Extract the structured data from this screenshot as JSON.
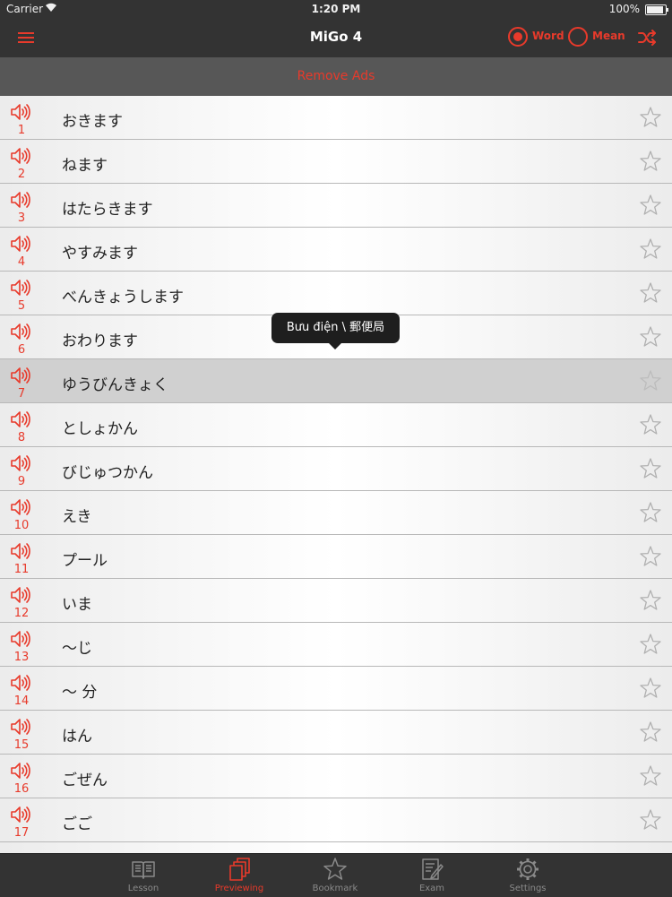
{
  "status_bar": {
    "carrier": "Carrier",
    "time": "1:20 PM",
    "battery": "100%",
    "battery_level": 1.0
  },
  "nav": {
    "title": "MiGo 4",
    "word_label": "Word",
    "mean_label": "Mean",
    "word_selected": true,
    "mean_selected": false,
    "accent_color": "#e83a2b"
  },
  "ads": {
    "label": "Remove Ads"
  },
  "tooltip": {
    "text": "Bưu điện \\ 郵便局"
  },
  "list": {
    "selected_index": 7,
    "items": [
      {
        "num": "1",
        "word": "おきます"
      },
      {
        "num": "2",
        "word": "ねます"
      },
      {
        "num": "3",
        "word": "はたらきます"
      },
      {
        "num": "4",
        "word": "やすみます"
      },
      {
        "num": "5",
        "word": "べんきょうします"
      },
      {
        "num": "6",
        "word": "おわります"
      },
      {
        "num": "7",
        "word": "ゆうびんきょく"
      },
      {
        "num": "8",
        "word": "としょかん"
      },
      {
        "num": "9",
        "word": "びじゅつかん"
      },
      {
        "num": "10",
        "word": "えき"
      },
      {
        "num": "11",
        "word": "プール"
      },
      {
        "num": "12",
        "word": "いま"
      },
      {
        "num": "13",
        "word": "～じ"
      },
      {
        "num": "14",
        "word": "～ 分"
      },
      {
        "num": "15",
        "word": "はん"
      },
      {
        "num": "16",
        "word": "ごぜん"
      },
      {
        "num": "17",
        "word": "ごご"
      }
    ]
  },
  "tabs": [
    {
      "label": "Lesson",
      "icon": "book-icon",
      "active": false
    },
    {
      "label": "Previewing",
      "icon": "cards-icon",
      "active": true
    },
    {
      "label": "Bookmark",
      "icon": "star-icon",
      "active": false
    },
    {
      "label": "Exam",
      "icon": "exam-icon",
      "active": false
    },
    {
      "label": "Settings",
      "icon": "gear-icon",
      "active": false
    }
  ]
}
